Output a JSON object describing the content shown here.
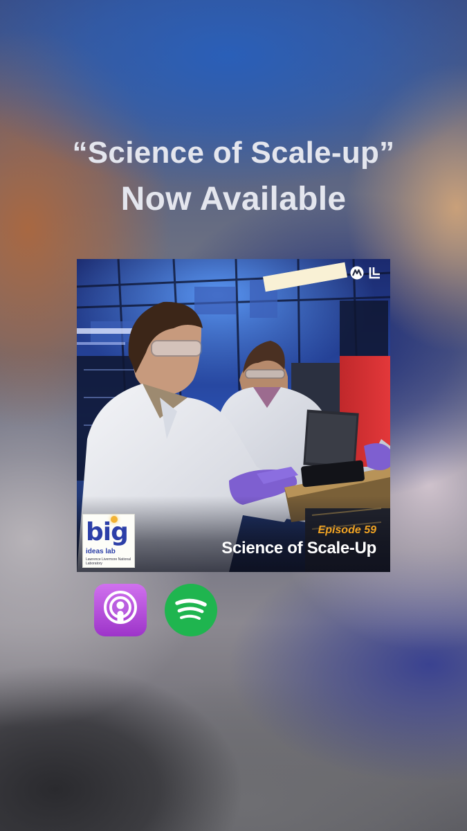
{
  "headline": {
    "line1": "“Science of Scale-up”",
    "line2": "Now Available"
  },
  "episode_card": {
    "show_logo": {
      "big": "big",
      "subtitle": "ideas lab",
      "lab_name": "Lawrence Livermore National Laboratory"
    },
    "episode_label": "Episode 59",
    "episode_title": "Science of Scale-Up",
    "corner_logos": [
      "podcast-network-logo",
      "llnl-logo"
    ]
  },
  "platforms": [
    {
      "name": "Apple Podcasts",
      "icon": "apple-podcasts-icon",
      "color": "#B150E2"
    },
    {
      "name": "Spotify",
      "icon": "spotify-icon",
      "color": "#1DB954"
    }
  ],
  "colors": {
    "headline_text": "#E4E6EE",
    "episode_label": "#F0A323",
    "episode_title": "#FFFFFF",
    "show_logo_blue": "#2C3FA8"
  }
}
